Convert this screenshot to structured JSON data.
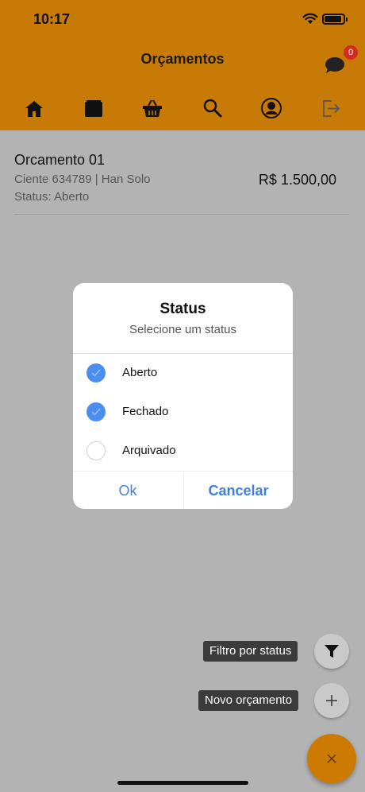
{
  "status_bar": {
    "time": "10:17"
  },
  "header": {
    "title": "Orçamentos",
    "notification_count": "0",
    "nav_icons": [
      "home-icon",
      "wallet-icon",
      "basket-icon",
      "search-icon",
      "user-icon",
      "logout-icon"
    ]
  },
  "list": {
    "items": [
      {
        "title": "Orcamento 01",
        "subtitle": "Ciente 634789 | Han Solo",
        "status": "Status: Aberto",
        "price": "R$ 1.500,00"
      }
    ]
  },
  "dialog": {
    "title": "Status",
    "subtitle": "Selecione um status",
    "options": [
      {
        "label": "Aberto",
        "checked": true
      },
      {
        "label": "Fechado",
        "checked": true
      },
      {
        "label": "Arquivado",
        "checked": false
      }
    ],
    "ok_label": "Ok",
    "cancel_label": "Cancelar",
    "accent_color": "#4a8ef0"
  },
  "fab": {
    "filter_tooltip": "Filtro por status",
    "new_tooltip": "Novo orçamento",
    "main_color": "#cc7a02"
  },
  "colors": {
    "header": "#c77a05",
    "overlay": "#b3b3b3",
    "badge": "#d32a22"
  }
}
